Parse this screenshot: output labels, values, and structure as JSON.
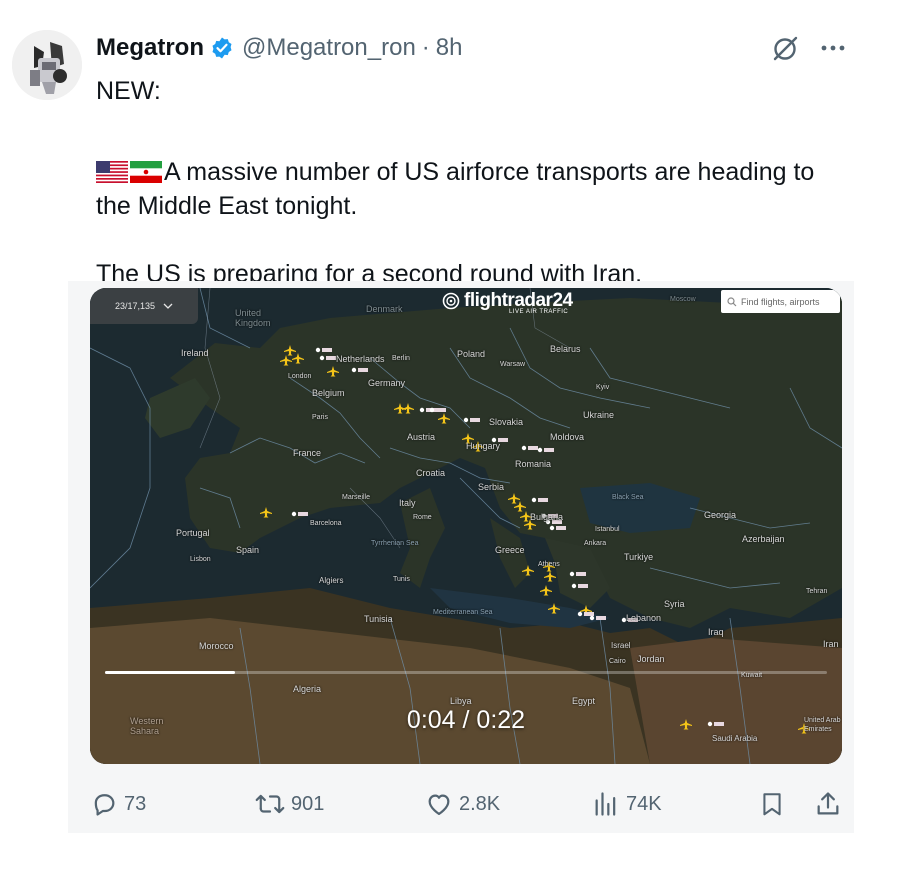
{
  "author": {
    "name": "Megatron",
    "handle": "@Megatron_ron",
    "separator": "·",
    "time_ago": "8h",
    "verified_color": "#1d9bf0"
  },
  "tweet": {
    "line1": "NEW:",
    "line2": "A massive number of US airforce transports are heading to the Middle East tonight.",
    "line3": "The US is preparing for a second round with Iran.",
    "flags": [
      "us-flag-icon",
      "iran-flag-icon"
    ]
  },
  "video": {
    "brand": "flightradar24",
    "brand_sub": "LIVE AIR TRAFFIC",
    "counter": "23/17,135",
    "search_placeholder": "Find flights, airports",
    "current_time": "0:04",
    "duration": "0:22",
    "time_display": "0:04 / 0:22",
    "progress_fraction": 0.18,
    "map_labels": {
      "ireland": "Ireland",
      "uk": "United Kingdom",
      "london": "London",
      "netherlands": "Netherlands",
      "belgium": "Belgium",
      "paris": "Paris",
      "france": "France",
      "germany": "Germany",
      "berlin": "Berlin",
      "denmark": "Denmark",
      "poland": "Poland",
      "warsaw": "Warsaw",
      "belarus": "Belarus",
      "kyiv": "Kyiv",
      "ukraine": "Ukraine",
      "moldova": "Moldova",
      "romania": "Romania",
      "austria": "Austria",
      "hungary": "Hungary",
      "slovakia": "Slovakia",
      "croatia": "Croatia",
      "serbia": "Serbia",
      "bulgaria": "Bulgaria",
      "istanbul": "Istanbul",
      "ankara": "Ankara",
      "turkiye": "Turkiye",
      "black_sea": "Black Sea",
      "georgia": "Georgia",
      "azerbaijan": "Azerbaijan",
      "tehran": "Tehran",
      "iran": "Iran",
      "iraq": "Iraq",
      "syria": "Syria",
      "lebanon": "Lebanon",
      "israel": "Israel",
      "jordan": "Jordan",
      "cairo": "Cairo",
      "egypt": "Egypt",
      "libya": "Libya",
      "greece": "Greece",
      "athens": "Athens",
      "italy": "Italy",
      "rome": "Rome",
      "tyrrhenian": "Tyrrhenian Sea",
      "mediterranean": "Mediterranean Sea",
      "marseille": "Marseille",
      "barcelona": "Barcelona",
      "spain": "Spain",
      "portugal": "Portugal",
      "lisbon": "Lisbon",
      "algiers": "Algiers",
      "tunis": "Tunis",
      "tunisia": "Tunisia",
      "morocco": "Morocco",
      "algeria": "Algeria",
      "western_sahara": "Western Sahara",
      "saudi": "Saudi Arabia",
      "kuwait": "Kuwait",
      "moscow": "Moscow",
      "uae": "United Arab Emirates"
    }
  },
  "metrics": {
    "replies": "73",
    "reposts": "901",
    "likes": "2.8K",
    "views": "74K"
  },
  "colors": {
    "text": "#0f1419",
    "muted": "#536471",
    "plane": "#f5c518"
  }
}
